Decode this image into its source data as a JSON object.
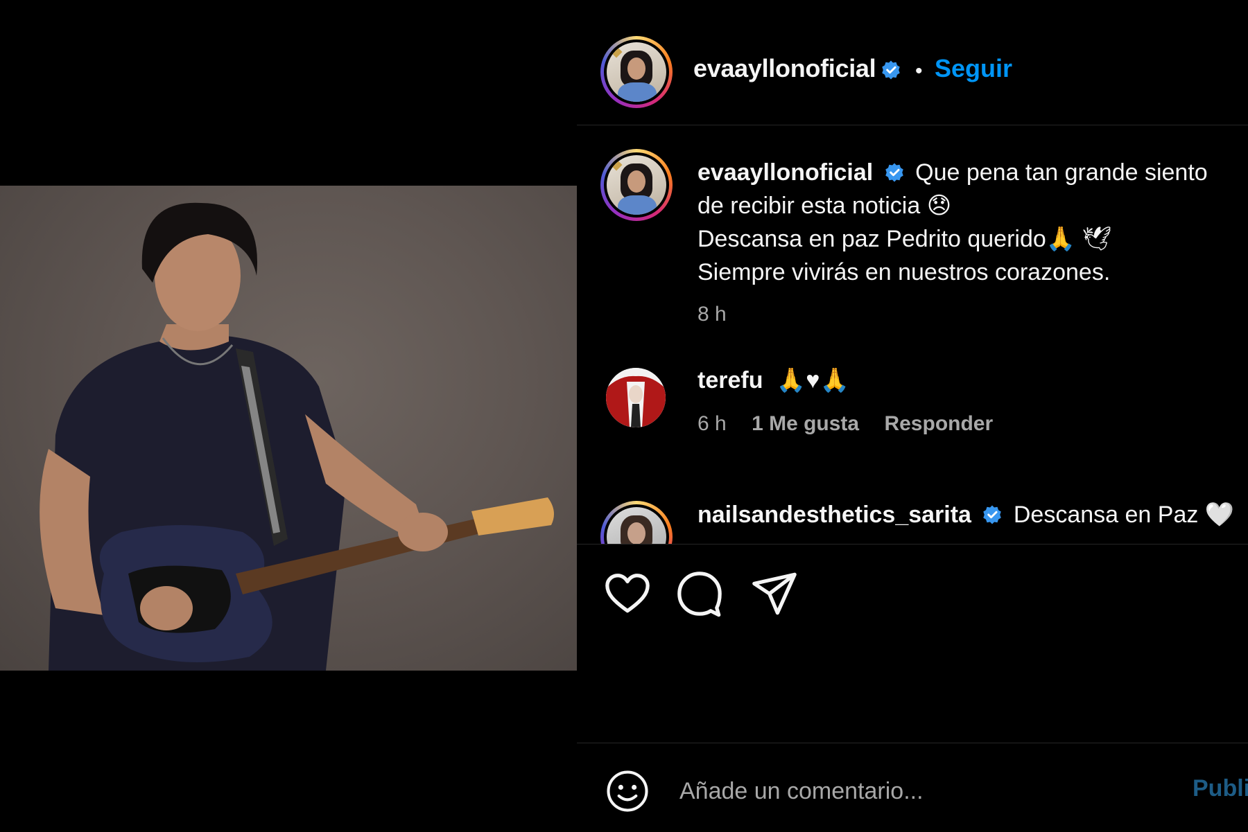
{
  "post": {
    "username": "evaayllonoficial",
    "verified": true,
    "follow_label": "Seguir",
    "separator": "•"
  },
  "caption": {
    "username": "evaayllonoficial",
    "line1": "Que pena tan grande siento",
    "line2": "de recibir esta noticia 😞",
    "line3": "Descansa en paz Pedrito querido🙏 🕊",
    "line4": "Siempre vivirás en nuestros corazones.",
    "time": "8 h"
  },
  "comments": [
    {
      "username": "terefu",
      "text": "🙏♥🙏",
      "time": "6 h",
      "likes": "1 Me gusta",
      "reply_label": "Responder"
    },
    {
      "username": "nailsandesthetics_sarita",
      "verified": true,
      "text": "Descansa en Paz 🤍"
    }
  ],
  "actions": {
    "like_icon": "heart-icon",
    "comment_icon": "comment-icon",
    "share_icon": "send-icon"
  },
  "composer": {
    "placeholder": "Añade un comentario...",
    "emoji_icon": "smiley-icon",
    "publish_label": "Publicar"
  },
  "colors": {
    "background": "#000000",
    "accent": "#0095f6",
    "muted": "#a8a8a8",
    "divider": "#262626"
  }
}
